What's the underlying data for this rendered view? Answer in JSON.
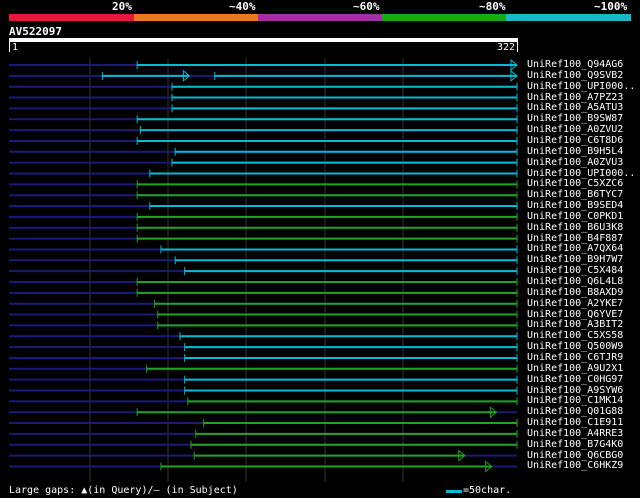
{
  "query_name": "AV522097",
  "ruler": {
    "start": "1",
    "end": "322"
  },
  "identity_scale": [
    {
      "label": "20%",
      "color": "#e8173a"
    },
    {
      "label": "~40%",
      "color": "#e67a22"
    },
    {
      "label": "~60%",
      "color": "#a030a8"
    },
    {
      "label": "~80%",
      "color": "#18a818"
    },
    {
      "label": "~100%",
      "color": "#18b8c8"
    }
  ],
  "colors": {
    "dim_line": "#1a1a7a",
    "grid": "#333333",
    "cyan": "#00bcd4",
    "green": "#1fa51f"
  },
  "hits": [
    {
      "label": "UniRef100_Q94AG6",
      "color": "cyan",
      "segments": [
        [
          82,
          322
        ]
      ],
      "arrow": true
    },
    {
      "label": "UniRef100_Q9SVB2",
      "color": "cyan",
      "segments": [
        [
          60,
          115
        ],
        [
          131,
          322
        ]
      ],
      "arrow": true
    },
    {
      "label": "UniRef100_UPI000..",
      "color": "cyan",
      "segments": [
        [
          104,
          322
        ]
      ],
      "arrow": false
    },
    {
      "label": "UniRef100_A7PZ23",
      "color": "cyan",
      "segments": [
        [
          104,
          322
        ]
      ],
      "arrow": false
    },
    {
      "label": "UniRef100_A5ATU3",
      "color": "cyan",
      "segments": [
        [
          104,
          322
        ]
      ],
      "arrow": false
    },
    {
      "label": "UniRef100_B9SW87",
      "color": "cyan",
      "segments": [
        [
          82,
          322
        ]
      ],
      "arrow": false
    },
    {
      "label": "UniRef100_A0ZVU2",
      "color": "cyan",
      "segments": [
        [
          84,
          322
        ]
      ],
      "arrow": false
    },
    {
      "label": "UniRef100_C6T8D6",
      "color": "cyan",
      "segments": [
        [
          82,
          322
        ]
      ],
      "arrow": false
    },
    {
      "label": "UniRef100_B9H5L4",
      "color": "cyan",
      "segments": [
        [
          106,
          322
        ]
      ],
      "arrow": false
    },
    {
      "label": "UniRef100_A0ZVU3",
      "color": "cyan",
      "segments": [
        [
          104,
          322
        ]
      ],
      "arrow": false
    },
    {
      "label": "UniRef100_UPI000..",
      "color": "cyan",
      "segments": [
        [
          90,
          322
        ]
      ],
      "arrow": false
    },
    {
      "label": "UniRef100_C5XZC6",
      "color": "green",
      "segments": [
        [
          82,
          322
        ]
      ],
      "arrow": false
    },
    {
      "label": "UniRef100_B6TYC7",
      "color": "green",
      "segments": [
        [
          82,
          322
        ]
      ],
      "arrow": false
    },
    {
      "label": "UniRef100_B9SED4",
      "color": "cyan",
      "segments": [
        [
          90,
          322
        ]
      ],
      "arrow": false
    },
    {
      "label": "UniRef100_C0PKD1",
      "color": "green",
      "segments": [
        [
          82,
          322
        ]
      ],
      "arrow": false
    },
    {
      "label": "UniRef100_B6U3K8",
      "color": "green",
      "segments": [
        [
          82,
          322
        ]
      ],
      "arrow": false
    },
    {
      "label": "UniRef100_B4F887",
      "color": "green",
      "segments": [
        [
          82,
          322
        ]
      ],
      "arrow": false
    },
    {
      "label": "UniRef100_A7QX64",
      "color": "cyan",
      "segments": [
        [
          97,
          322
        ]
      ],
      "arrow": false
    },
    {
      "label": "UniRef100_B9H7W7",
      "color": "cyan",
      "segments": [
        [
          106,
          322
        ]
      ],
      "arrow": false
    },
    {
      "label": "UniRef100_C5X484",
      "color": "cyan",
      "segments": [
        [
          112,
          322
        ]
      ],
      "arrow": false
    },
    {
      "label": "UniRef100_Q6L4L8",
      "color": "green",
      "segments": [
        [
          82,
          322
        ]
      ],
      "arrow": false
    },
    {
      "label": "UniRef100_B8AXD9",
      "color": "green",
      "segments": [
        [
          82,
          322
        ]
      ],
      "arrow": false
    },
    {
      "label": "UniRef100_A2YKE7",
      "color": "green",
      "segments": [
        [
          93,
          322
        ]
      ],
      "arrow": false
    },
    {
      "label": "UniRef100_Q6YVE7",
      "color": "green",
      "segments": [
        [
          95,
          322
        ]
      ],
      "arrow": false
    },
    {
      "label": "UniRef100_A3BIT2",
      "color": "green",
      "segments": [
        [
          95,
          322
        ]
      ],
      "arrow": false
    },
    {
      "label": "UniRef100_C5XS58",
      "color": "cyan",
      "segments": [
        [
          109,
          322
        ]
      ],
      "arrow": false
    },
    {
      "label": "UniRef100_Q500W9",
      "color": "cyan",
      "segments": [
        [
          112,
          322
        ]
      ],
      "arrow": false
    },
    {
      "label": "UniRef100_C6TJR9",
      "color": "cyan",
      "segments": [
        [
          112,
          322
        ]
      ],
      "arrow": false
    },
    {
      "label": "UniRef100_A9U2X1",
      "color": "green",
      "segments": [
        [
          88,
          322
        ]
      ],
      "arrow": false
    },
    {
      "label": "UniRef100_C0HG97",
      "color": "cyan",
      "segments": [
        [
          112,
          322
        ]
      ],
      "arrow": false
    },
    {
      "label": "UniRef100_A9SYW6",
      "color": "cyan",
      "segments": [
        [
          112,
          322
        ]
      ],
      "arrow": false
    },
    {
      "label": "UniRef100_C1MK14",
      "color": "green",
      "segments": [
        [
          114,
          322
        ]
      ],
      "arrow": false
    },
    {
      "label": "UniRef100_Q01G88",
      "color": "green",
      "segments": [
        [
          82,
          309
        ]
      ],
      "arrow": true
    },
    {
      "label": "UniRef100_C1E911",
      "color": "green",
      "segments": [
        [
          124,
          322
        ]
      ],
      "arrow": false
    },
    {
      "label": "UniRef100_A4RRE3",
      "color": "green",
      "segments": [
        [
          119,
          322
        ]
      ],
      "arrow": false
    },
    {
      "label": "UniRef100_B7G4K0",
      "color": "green",
      "segments": [
        [
          116,
          322
        ]
      ],
      "arrow": false
    },
    {
      "label": "UniRef100_Q6CBG0",
      "color": "green",
      "segments": [
        [
          118,
          289
        ]
      ],
      "arrow": true
    },
    {
      "label": "UniRef100_C6HKZ9",
      "color": "green",
      "segments": [
        [
          97,
          306
        ]
      ],
      "arrow": true
    }
  ],
  "footer": {
    "gaps_text": "Large gaps: ▲(in Query)/— (in Subject)",
    "legend_text": "=50char."
  }
}
